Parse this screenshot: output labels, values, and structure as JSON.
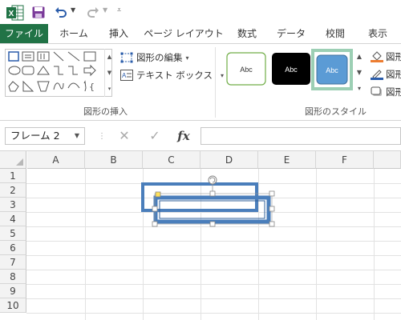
{
  "qat": {
    "app_icon": "excel-icon",
    "save_icon": "save-icon",
    "undo_icon": "undo-icon",
    "redo_icon": "redo-icon",
    "customize_icon": "customize-qat-icon"
  },
  "tabs": [
    {
      "label": "ファイル",
      "active": true
    },
    {
      "label": "ホーム"
    },
    {
      "label": "挿入"
    },
    {
      "label": "ページ レイアウト"
    },
    {
      "label": "数式"
    },
    {
      "label": "データ"
    },
    {
      "label": "校閲"
    },
    {
      "label": "表示"
    }
  ],
  "ribbon": {
    "insert_shapes": {
      "edit_shape_label": "図形の編集",
      "text_box_label": "テキスト ボックス",
      "group_label": "図形の挿入"
    },
    "shape_styles": {
      "style_text": "Abc",
      "group_label": "図形のスタイル",
      "colors": {
        "outline_green": "#70ad47",
        "black": "#000000",
        "blue": "#5b9bd5",
        "selected_border": "#9ccfb4"
      }
    },
    "right_labels": [
      "図形",
      "図形",
      "図形"
    ]
  },
  "formula_bar": {
    "name_box_value": "フレーム 2",
    "cancel_glyph": "✕",
    "enter_glyph": "✓",
    "fx_label": "fx",
    "formula_value": ""
  },
  "grid": {
    "columns": [
      "A",
      "B",
      "C",
      "D",
      "E",
      "F"
    ],
    "rows": [
      "1",
      "2",
      "3",
      "4",
      "5",
      "6",
      "7",
      "8",
      "9",
      "10"
    ]
  },
  "selection": {
    "accent": "#4a7ebb",
    "shape_name": "フレーム 2"
  }
}
